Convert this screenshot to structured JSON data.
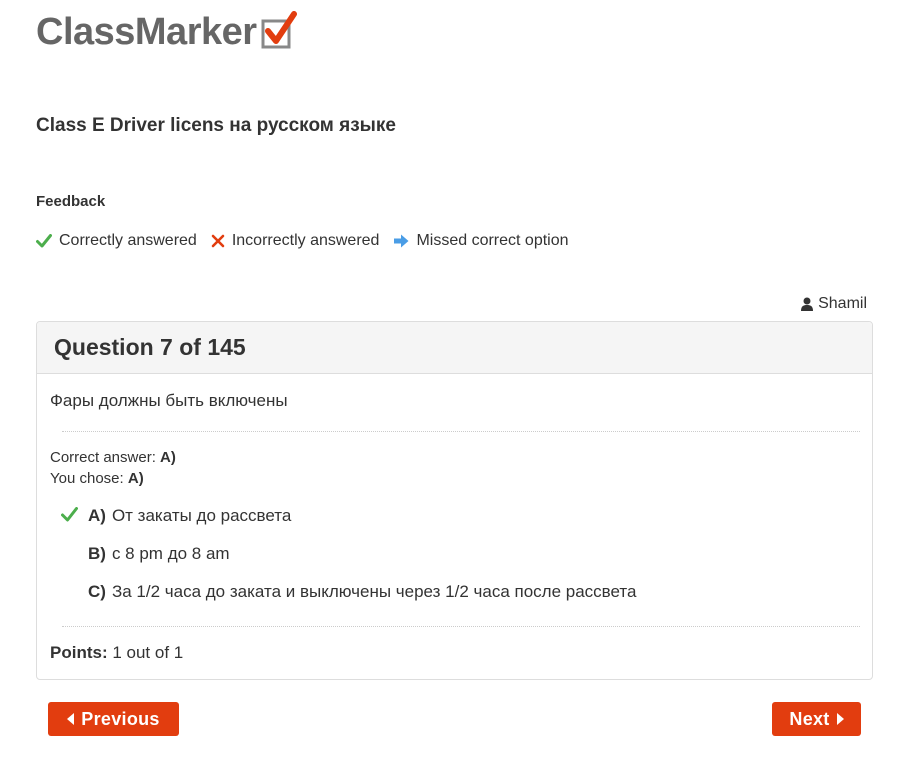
{
  "logo": {
    "text": "ClassMarker",
    "accent_color": "#e23d0f"
  },
  "test": {
    "title": "Class E Driver licens на русском языке"
  },
  "feedback": {
    "label": "Feedback",
    "legend": [
      {
        "icon": "green-check-icon",
        "color": "#4cae4c",
        "label": "Correctly answered"
      },
      {
        "icon": "red-cross-icon",
        "color": "#e23d0f",
        "label": "Incorrectly answered"
      },
      {
        "icon": "blue-arrow-right-icon",
        "color": "#4a9de6",
        "label": "Missed correct option"
      }
    ]
  },
  "user": {
    "icon": "user-icon",
    "name": "Shamil"
  },
  "question": {
    "heading": "Question 7 of 145",
    "text": "Фары должны быть включены",
    "correct_answer_label": "Correct answer:",
    "correct_answer_value": "A)",
    "you_chose_label": "You chose:",
    "you_chose_value": "A)",
    "options": [
      {
        "letter": "A)",
        "text": "От закаты до рассвета",
        "marked": "green-check-icon"
      },
      {
        "letter": "B)",
        "text": "с 8 pm до 8 am",
        "marked": ""
      },
      {
        "letter": "C)",
        "text": "За 1/2 часа до заката и выключены через 1/2 часа после рассвета",
        "marked": ""
      }
    ],
    "points_label": "Points:",
    "points_value": "1 out of 1"
  },
  "nav": {
    "previous_label": "Previous",
    "next_label": "Next",
    "button_color": "#e23d0f"
  }
}
